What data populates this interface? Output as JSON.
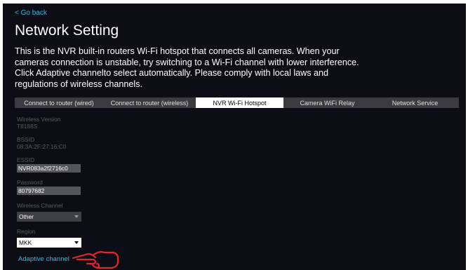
{
  "nav": {
    "back_label": "< Go back"
  },
  "page": {
    "title": "Network Setting",
    "description": "This is the NVR built-in routers Wi-Fi hotspot that connects all cameras. When your cameras connection is unstable, try switching to a Wi-Fi channel with lower interference. Click Adaptive channelto select automatically. Please comply with local laws and regulations of wireless channels."
  },
  "tabs": [
    {
      "label": "Connect to router (wired)",
      "active": false
    },
    {
      "label": "Connect to router (wireless)",
      "active": false
    },
    {
      "label": "NVR Wi-Fi Hotspot",
      "active": true
    },
    {
      "label": "Camera WiFi Relay",
      "active": false
    },
    {
      "label": "Network Service",
      "active": false
    }
  ],
  "fields": {
    "wireless_version": {
      "label": "Wireless Version",
      "value": "T8188S"
    },
    "bssid": {
      "label": "BSSID",
      "value": "08:3A:2F:27:16:C0"
    },
    "essid": {
      "label": "ESSID",
      "value": "NVR083a2f2716c0"
    },
    "password": {
      "label": "Password",
      "value": "80797682"
    },
    "wireless_channel": {
      "label": "Wireless Channel",
      "value": "Other"
    },
    "region": {
      "label": "Region",
      "value": "MKK"
    }
  },
  "actions": {
    "adaptive_channel_label": "Adaptive channel"
  },
  "colors": {
    "accent": "#3db8e0",
    "background": "#0d0d15",
    "tab_bar": "#3a3a3f",
    "hand_pointer": "#e0262b"
  },
  "icons": {
    "hand": "pointing-hand-icon"
  }
}
